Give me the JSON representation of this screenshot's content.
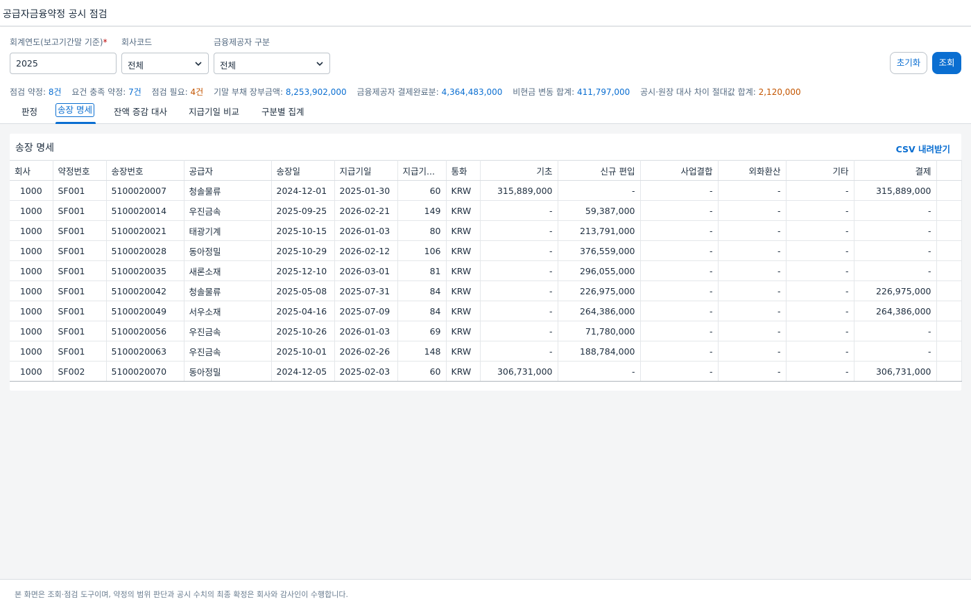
{
  "header": {
    "title": "공급자금융약정 공시 점검"
  },
  "filters": {
    "fiscal_year": {
      "label": "회계연도(보고기간말 기준)",
      "required_mark": "*",
      "value": "2025"
    },
    "company_code": {
      "label": "회사코드",
      "value": "전체"
    },
    "provider_type": {
      "label": "금융제공자 구분",
      "value": "전체"
    },
    "reset_label": "초기화",
    "search_label": "조회"
  },
  "summary": {
    "checked_label": "점검 약정:",
    "checked_value": "8건",
    "met_label": "요건 충족 약정:",
    "met_value": "7건",
    "needs_label": "점검 필요:",
    "needs_value": "4건",
    "carrying_label": "기말 부채 장부금액:",
    "carrying_value": "8,253,902,000",
    "paid_label": "금융제공자 결제완료분:",
    "paid_value": "4,364,483,000",
    "noncash_label": "비현금 변동 합계:",
    "noncash_value": "411,797,000",
    "diff_label": "공시·원장 대사 차이 절대값 합계:",
    "diff_value": "2,120,000"
  },
  "tabs": [
    "판정",
    "송장 명세",
    "잔액 증감 대사",
    "지급기일 비교",
    "구분별 집계"
  ],
  "active_tab": 1,
  "card": {
    "title": "송장 명세",
    "csv_label": "CSV 내려받기"
  },
  "table": {
    "columns": [
      "회사",
      "약정번호",
      "송장번호",
      "공급자",
      "송장일",
      "지급기일",
      "지급기...",
      "통화",
      "기초",
      "신규 편입",
      "사업결합",
      "외화환산",
      "기타",
      "결제"
    ],
    "rows": [
      [
        "1000",
        "SF001",
        "5100020007",
        "청솔물류",
        "2024-12-01",
        "2025-01-30",
        "60",
        "KRW",
        "315,889,000",
        "-",
        "-",
        "-",
        "-",
        "315,889,000"
      ],
      [
        "1000",
        "SF001",
        "5100020014",
        "우진금속",
        "2025-09-25",
        "2026-02-21",
        "149",
        "KRW",
        "-",
        "59,387,000",
        "-",
        "-",
        "-",
        "-"
      ],
      [
        "1000",
        "SF001",
        "5100020021",
        "태광기계",
        "2025-10-15",
        "2026-01-03",
        "80",
        "KRW",
        "-",
        "213,791,000",
        "-",
        "-",
        "-",
        "-"
      ],
      [
        "1000",
        "SF001",
        "5100020028",
        "동아정밀",
        "2025-10-29",
        "2026-02-12",
        "106",
        "KRW",
        "-",
        "376,559,000",
        "-",
        "-",
        "-",
        "-"
      ],
      [
        "1000",
        "SF001",
        "5100020035",
        "새론소재",
        "2025-12-10",
        "2026-03-01",
        "81",
        "KRW",
        "-",
        "296,055,000",
        "-",
        "-",
        "-",
        "-"
      ],
      [
        "1000",
        "SF001",
        "5100020042",
        "청솔물류",
        "2025-05-08",
        "2025-07-31",
        "84",
        "KRW",
        "-",
        "226,975,000",
        "-",
        "-",
        "-",
        "226,975,000"
      ],
      [
        "1000",
        "SF001",
        "5100020049",
        "서우소재",
        "2025-04-16",
        "2025-07-09",
        "84",
        "KRW",
        "-",
        "264,386,000",
        "-",
        "-",
        "-",
        "264,386,000"
      ],
      [
        "1000",
        "SF001",
        "5100020056",
        "우진금속",
        "2025-10-26",
        "2026-01-03",
        "69",
        "KRW",
        "-",
        "71,780,000",
        "-",
        "-",
        "-",
        "-"
      ],
      [
        "1000",
        "SF001",
        "5100020063",
        "우진금속",
        "2025-10-01",
        "2026-02-26",
        "148",
        "KRW",
        "-",
        "188,784,000",
        "-",
        "-",
        "-",
        "-"
      ],
      [
        "1000",
        "SF002",
        "5100020070",
        "동아정밀",
        "2024-12-05",
        "2025-02-03",
        "60",
        "KRW",
        "306,731,000",
        "-",
        "-",
        "-",
        "-",
        "306,731,000"
      ]
    ]
  },
  "footer": {
    "note": "본 화면은 조회·점검 도구이며, 약정의 범위 판단과 공시 수치의 최종 확정은 회사와 감사인이 수행합니다."
  },
  "colors": {
    "accent": "#0a6ed1",
    "warning": "#c35500",
    "required": "#bb0000"
  }
}
